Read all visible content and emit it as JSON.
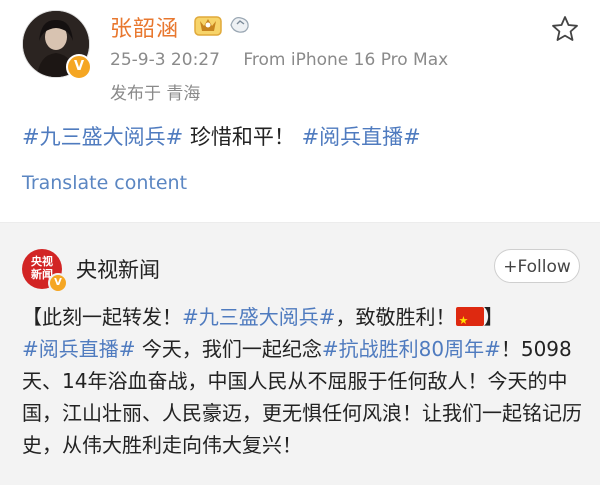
{
  "author": {
    "name": "张韶涵",
    "time": "25-9-3 20:27",
    "device": "From iPhone 16 Pro Max",
    "location": "发布于 青海"
  },
  "post": {
    "tag1": "#九三盛大阅兵#",
    "text": " 珍惜和平！",
    "tag2": "#阅兵直播#",
    "translate_label": "Translate content"
  },
  "repost": {
    "source_name": "央视新闻",
    "logo_text_1": "央视",
    "logo_text_2": "新闻",
    "follow_label": "Follow",
    "text_part1": "【此刻一起转发！",
    "tag_a": "#九三盛大阅兵#",
    "text_part2": "，致敬胜利！",
    "text_part3": "】",
    "tag_b": "#阅兵直播#",
    "text_part4": " 今天，我们一起纪念",
    "tag_c": "#抗战胜利80周年#",
    "text_part5": "！5098天、14年浴血奋战，中国人民从不屈服于任何敌人！今天的中国，江山壮丽、人民豪迈，更无惧任何风浪！让我们一起铭记历史，从伟大胜利走向伟大复兴！"
  },
  "colors": {
    "name": "#e8772e",
    "link": "#4f7bbf",
    "repost_bg": "#f3f3f3",
    "verified": "#f5a623",
    "cctv_red": "#d22424"
  },
  "icons": {
    "star": "star-icon",
    "vip": "vip-crown-icon",
    "fan": "fan-badge-icon",
    "verified": "verified-v-icon",
    "flag": "china-flag-icon"
  }
}
